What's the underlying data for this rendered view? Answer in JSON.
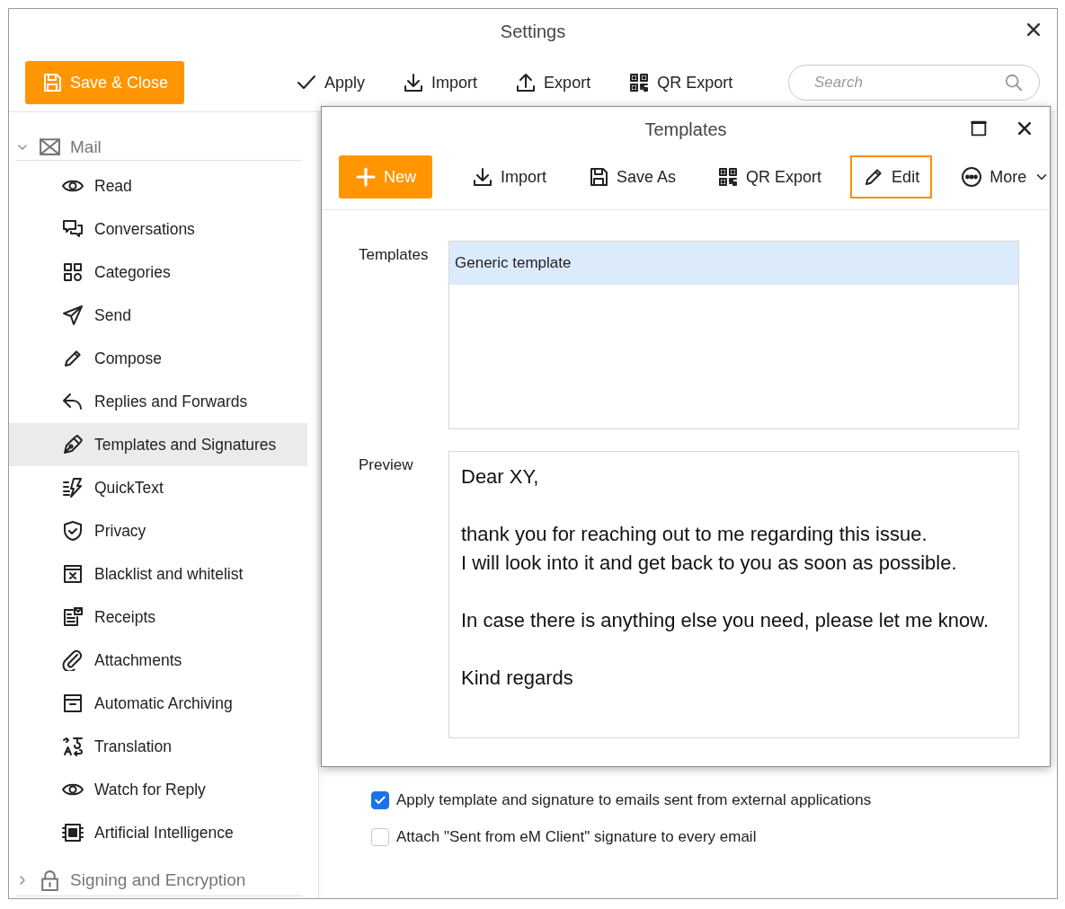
{
  "window": {
    "title": "Settings"
  },
  "toolbar": [
    {
      "label": "Save & Close",
      "kind": "primary"
    },
    {
      "label": "Apply",
      "kind": "plain"
    },
    {
      "label": "Import",
      "kind": "plain"
    },
    {
      "label": "Export",
      "kind": "plain"
    },
    {
      "label": "QR Export",
      "kind": "plain"
    }
  ],
  "search": {
    "placeholder": "Search"
  },
  "sidebar": {
    "groups": [
      {
        "label": "Mail",
        "expanded": true,
        "children": [
          {
            "label": "Read",
            "selected": false
          },
          {
            "label": "Conversations",
            "selected": false
          },
          {
            "label": "Categories",
            "selected": false
          },
          {
            "label": "Send",
            "selected": false
          },
          {
            "label": "Compose",
            "selected": false
          },
          {
            "label": "Replies and Forwards",
            "selected": false
          },
          {
            "label": "Templates and Signatures",
            "selected": true
          },
          {
            "label": "QuickText",
            "selected": false
          },
          {
            "label": "Privacy",
            "selected": false
          },
          {
            "label": "Blacklist and whitelist",
            "selected": false
          },
          {
            "label": "Receipts",
            "selected": false
          },
          {
            "label": "Attachments",
            "selected": false
          },
          {
            "label": "Automatic Archiving",
            "selected": false
          },
          {
            "label": "Translation",
            "selected": false
          },
          {
            "label": "Watch for Reply",
            "selected": false
          },
          {
            "label": "Artificial Intelligence",
            "selected": false
          }
        ]
      },
      {
        "label": "Signing and Encryption",
        "expanded": false
      }
    ]
  },
  "options": [
    {
      "label": "Apply template and signature to emails sent from external applications",
      "checked": true
    },
    {
      "label": "Attach \"Sent from eM Client\" signature to every email",
      "checked": false
    }
  ],
  "dialog": {
    "title": "Templates",
    "toolbar": [
      {
        "label": "New",
        "kind": "primary",
        "focused": false
      },
      {
        "label": "Import",
        "kind": "plain",
        "focused": false
      },
      {
        "label": "Save As",
        "kind": "plain",
        "focused": false
      },
      {
        "label": "QR Export",
        "kind": "plain",
        "focused": false
      },
      {
        "label": "Edit",
        "kind": "plain",
        "focused": true
      },
      {
        "label": "More",
        "kind": "menu",
        "focused": false
      }
    ],
    "templates_label": "Templates",
    "templates": [
      {
        "name": "Generic template",
        "selected": true
      }
    ],
    "preview_label": "Preview",
    "preview": [
      "Dear XY,",
      "thank you for reaching out to me regarding this issue.\nI will look into it and get back to you as soon as possible.",
      "In case there is anything else you need, please let me know.",
      "Kind regards"
    ]
  }
}
